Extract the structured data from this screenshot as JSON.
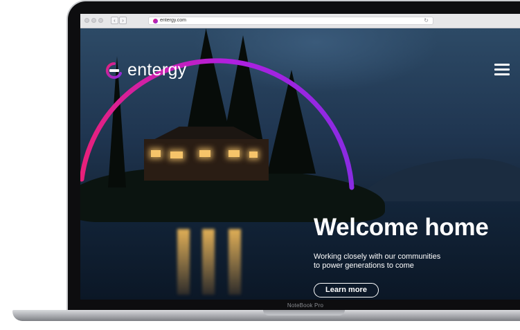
{
  "browser": {
    "url": "entergy.com"
  },
  "site": {
    "brand": "entergy",
    "brand_colors": [
      "#e8207a",
      "#8a2be2"
    ],
    "menu_icon": "hamburger-menu-icon"
  },
  "hero": {
    "headline": "Welcome home",
    "subtext_line1": "Working closely with our communities",
    "subtext_line2": "to power generations to come",
    "cta_label": "Learn more"
  },
  "device": {
    "model_label": "NoteBook Pro"
  }
}
